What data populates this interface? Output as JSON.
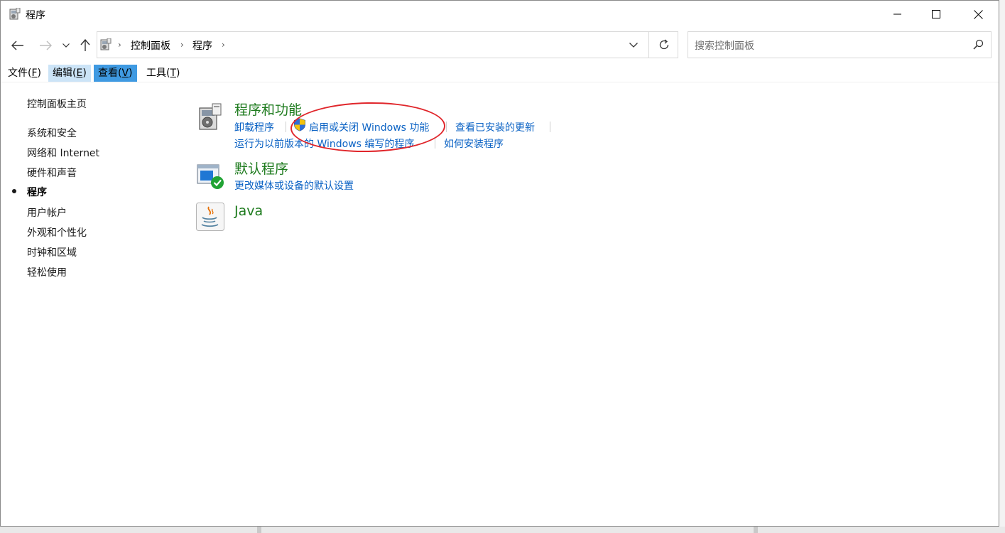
{
  "window": {
    "title": "程序"
  },
  "address": {
    "breadcrumb": [
      "控制面板",
      "程序"
    ],
    "search_placeholder": "搜索控制面板"
  },
  "menu": {
    "file": "文件",
    "file_key": "F",
    "edit": "编辑",
    "edit_key": "E",
    "view": "查看",
    "view_key": "V",
    "tools": "工具",
    "tools_key": "T"
  },
  "sidebar": {
    "home": "控制面板主页",
    "items": [
      {
        "label": "系统和安全"
      },
      {
        "label": "网络和 Internet"
      },
      {
        "label": "硬件和声音"
      },
      {
        "label": "程序",
        "current": true
      },
      {
        "label": "用户帐户"
      },
      {
        "label": "外观和个性化"
      },
      {
        "label": "时钟和区域"
      },
      {
        "label": "轻松使用"
      }
    ]
  },
  "categories": [
    {
      "title": "程序和功能",
      "icon": "programs-features-icon",
      "links": [
        "卸载程序",
        "启用或关闭 Windows 功能",
        "查看已安装的更新",
        "运行为以前版本的 Windows 编写的程序",
        "如何安装程序"
      ]
    },
    {
      "title": "默认程序",
      "icon": "default-programs-icon",
      "links": [
        "更改媒体或设备的默认设置"
      ]
    },
    {
      "title": "Java",
      "icon": "java-icon",
      "links": []
    }
  ],
  "colors": {
    "category_title": "#1e7b1e",
    "link": "#0a62c4",
    "highlight": "#e0262b",
    "menu_view_bg": "#3f9ae2",
    "menu_edit_bg": "#cce4f7"
  }
}
